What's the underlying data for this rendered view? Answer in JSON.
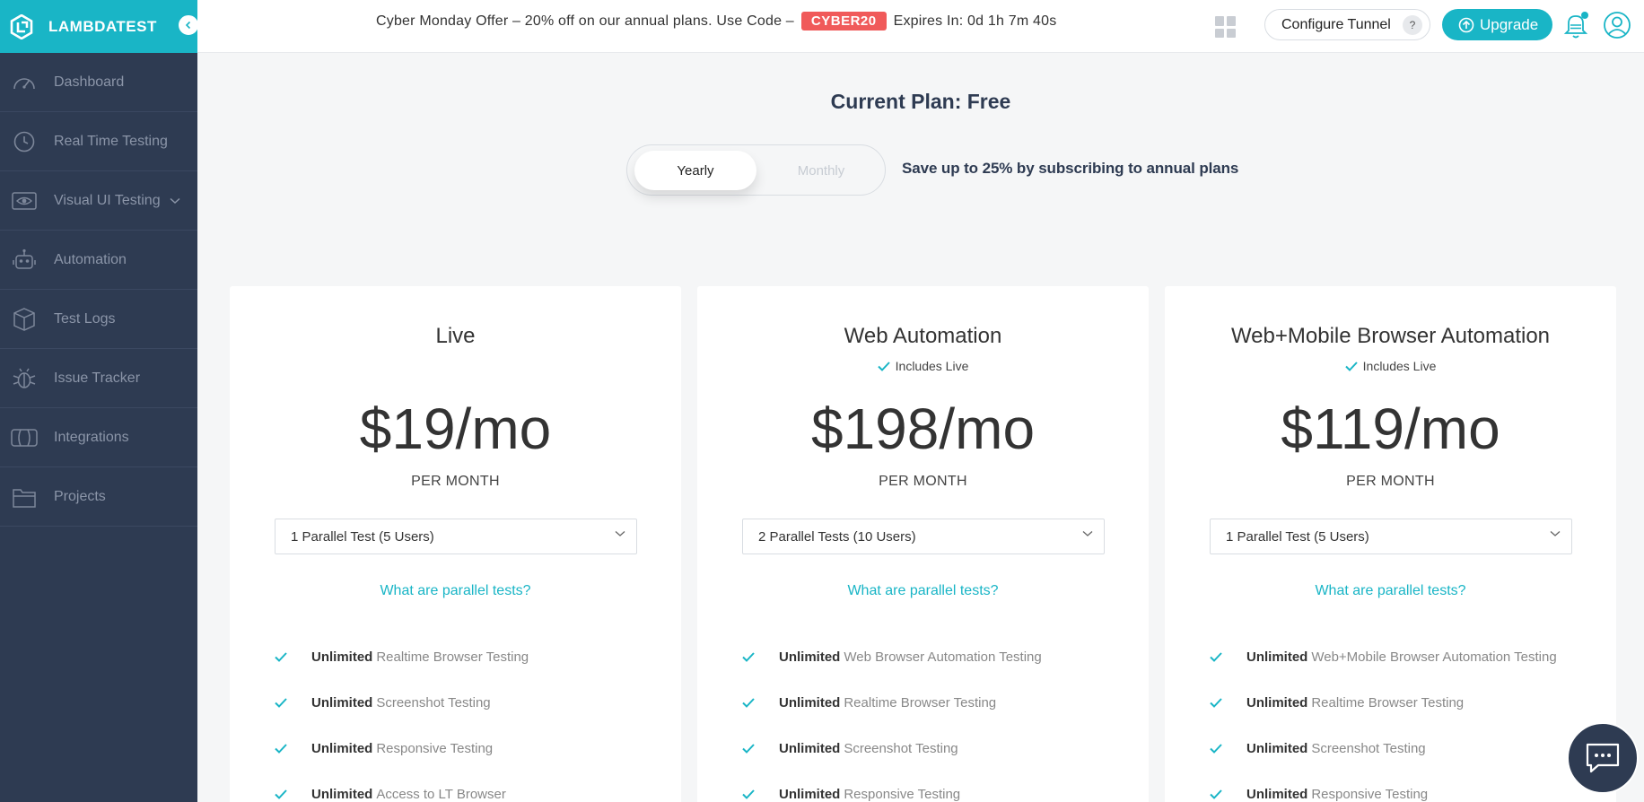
{
  "brand": {
    "name": "LAMBDATEST"
  },
  "sidebar": {
    "items": [
      {
        "label": "Dashboard",
        "icon": "dashboard-icon"
      },
      {
        "label": "Real Time Testing",
        "icon": "clock-icon"
      },
      {
        "label": "Visual UI Testing",
        "icon": "eye-icon",
        "expandable": true
      },
      {
        "label": "Automation",
        "icon": "robot-icon"
      },
      {
        "label": "Test Logs",
        "icon": "box-icon"
      },
      {
        "label": "Issue Tracker",
        "icon": "bug-icon"
      },
      {
        "label": "Integrations",
        "icon": "puzzle-icon"
      },
      {
        "label": "Projects",
        "icon": "folder-icon"
      }
    ]
  },
  "topbar": {
    "offer_text": "Cyber Monday Offer – 20% off on our annual plans. Use Code –",
    "coupon": "CYBER20",
    "expires": "Expires In: 0d 1h 7m 40s",
    "tunnel_label": "Configure Tunnel",
    "tunnel_help": "?",
    "upgrade_label": "Upgrade"
  },
  "main": {
    "current_plan": "Current Plan: Free",
    "billing_toggle": {
      "selected": "Yearly",
      "other": "Monthly"
    },
    "save_note": "Save up to 25% by subscribing to annual plans",
    "cards": [
      {
        "title": "Live",
        "includes": "",
        "price": "$19/mo",
        "period": "PER MONTH",
        "select_value": "1 Parallel Test (5 Users)",
        "link": "What are parallel tests?",
        "features": [
          {
            "bold": "Unlimited",
            "rest": "Realtime Browser Testing"
          },
          {
            "bold": "Unlimited",
            "rest": "Screenshot Testing"
          },
          {
            "bold": "Unlimited",
            "rest": "Responsive Testing"
          },
          {
            "bold": "Unlimited",
            "rest": "Access to LT Browser"
          }
        ]
      },
      {
        "title": "Web Automation",
        "includes": "Includes Live",
        "price": "$198/mo",
        "period": "PER MONTH",
        "select_value": "2 Parallel Tests (10 Users)",
        "link": "What are parallel tests?",
        "features": [
          {
            "bold": "Unlimited",
            "rest": "Web Browser Automation Testing"
          },
          {
            "bold": "Unlimited",
            "rest": "Realtime Browser Testing"
          },
          {
            "bold": "Unlimited",
            "rest": "Screenshot Testing"
          },
          {
            "bold": "Unlimited",
            "rest": "Responsive Testing"
          }
        ]
      },
      {
        "title": "Web+Mobile Browser Automation",
        "includes": "Includes Live",
        "price": "$119/mo",
        "period": "PER MONTH",
        "select_value": "1 Parallel Test (5 Users)",
        "link": "What are parallel tests?",
        "features": [
          {
            "bold": "Unlimited",
            "rest": "Web+Mobile Browser Automation Testing"
          },
          {
            "bold": "Unlimited",
            "rest": "Realtime Browser Testing"
          },
          {
            "bold": "Unlimited",
            "rest": "Screenshot Testing"
          },
          {
            "bold": "Unlimited",
            "rest": "Responsive Testing"
          }
        ]
      }
    ]
  },
  "colors": {
    "accent": "#19b5c6",
    "sidebar": "#2e3b52",
    "coupon": "#f05a5a"
  }
}
